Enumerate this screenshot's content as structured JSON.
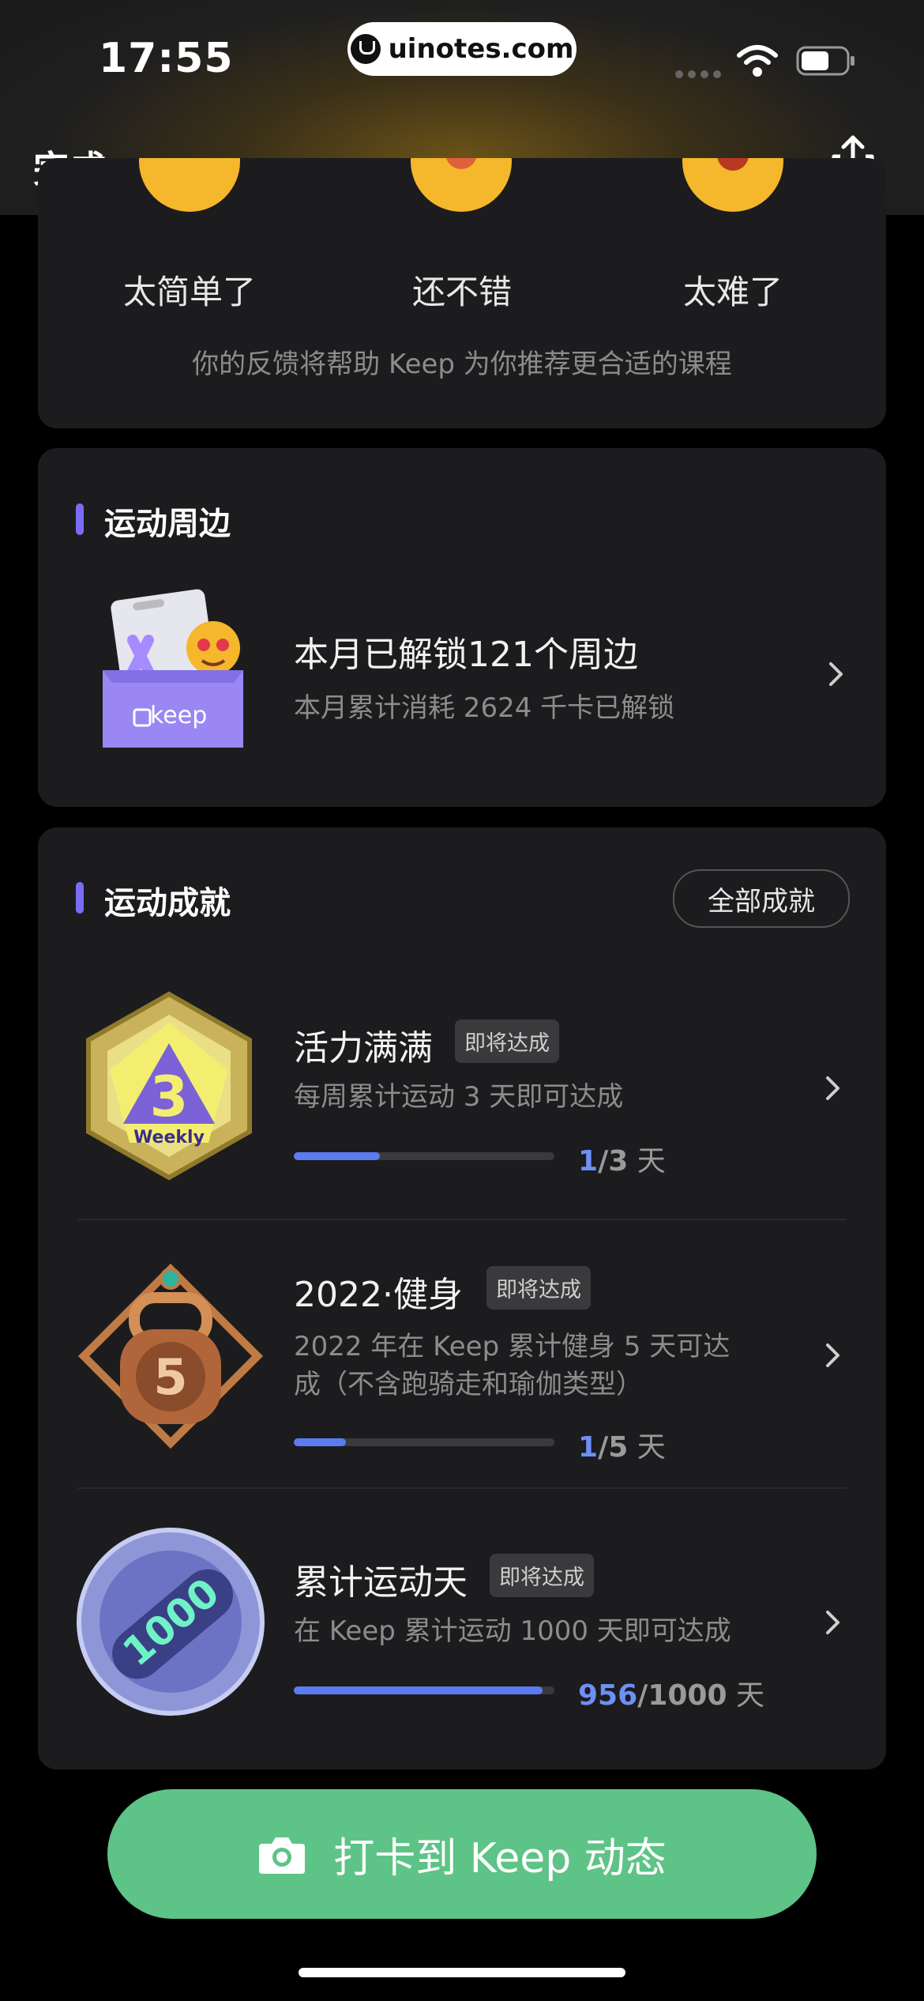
{
  "status_bar": {
    "time": "17:55",
    "url": "uinotes.com"
  },
  "nav": {
    "done_label": "完成"
  },
  "feedback": {
    "options": [
      "太简单了",
      "还不错",
      "太难了"
    ],
    "hint": "你的反馈将帮助 Keep 为你推荐更合适的课程"
  },
  "merch": {
    "section_title": "运动周边",
    "box_brand": "keep",
    "title": "本月已解锁121个周边",
    "subtitle": "本月累计消耗 2624 千卡已解锁"
  },
  "achievements": {
    "section_title": "运动成就",
    "all_button": "全部成就",
    "items": [
      {
        "title": "活力满满",
        "badge": "即将达成",
        "desc": "每周累计运动 3 天即可达成",
        "current": "1",
        "total": "3",
        "unit": "天",
        "progress": 0.33,
        "medal_text": "Weekly"
      },
      {
        "title": "2022·健身",
        "badge": "即将达成",
        "desc_line1": "2022 年在 Keep 累计健身 5 天可达",
        "desc_line2": "成（不含跑骑走和瑜伽类型）",
        "current": "1",
        "total": "5",
        "unit": "天",
        "progress": 0.2,
        "medal_text": "5"
      },
      {
        "title": "累计运动天",
        "badge": "即将达成",
        "desc": "在 Keep 累计运动 1000 天即可达成",
        "current": "956",
        "total": "1000",
        "unit": "天",
        "progress": 0.956,
        "medal_text": "1000"
      }
    ]
  },
  "cta": {
    "label": "打卡到 Keep 动态"
  },
  "colors": {
    "accent": "#7b6cf6",
    "progress": "#5b7cf0",
    "cta": "#5ec386"
  }
}
